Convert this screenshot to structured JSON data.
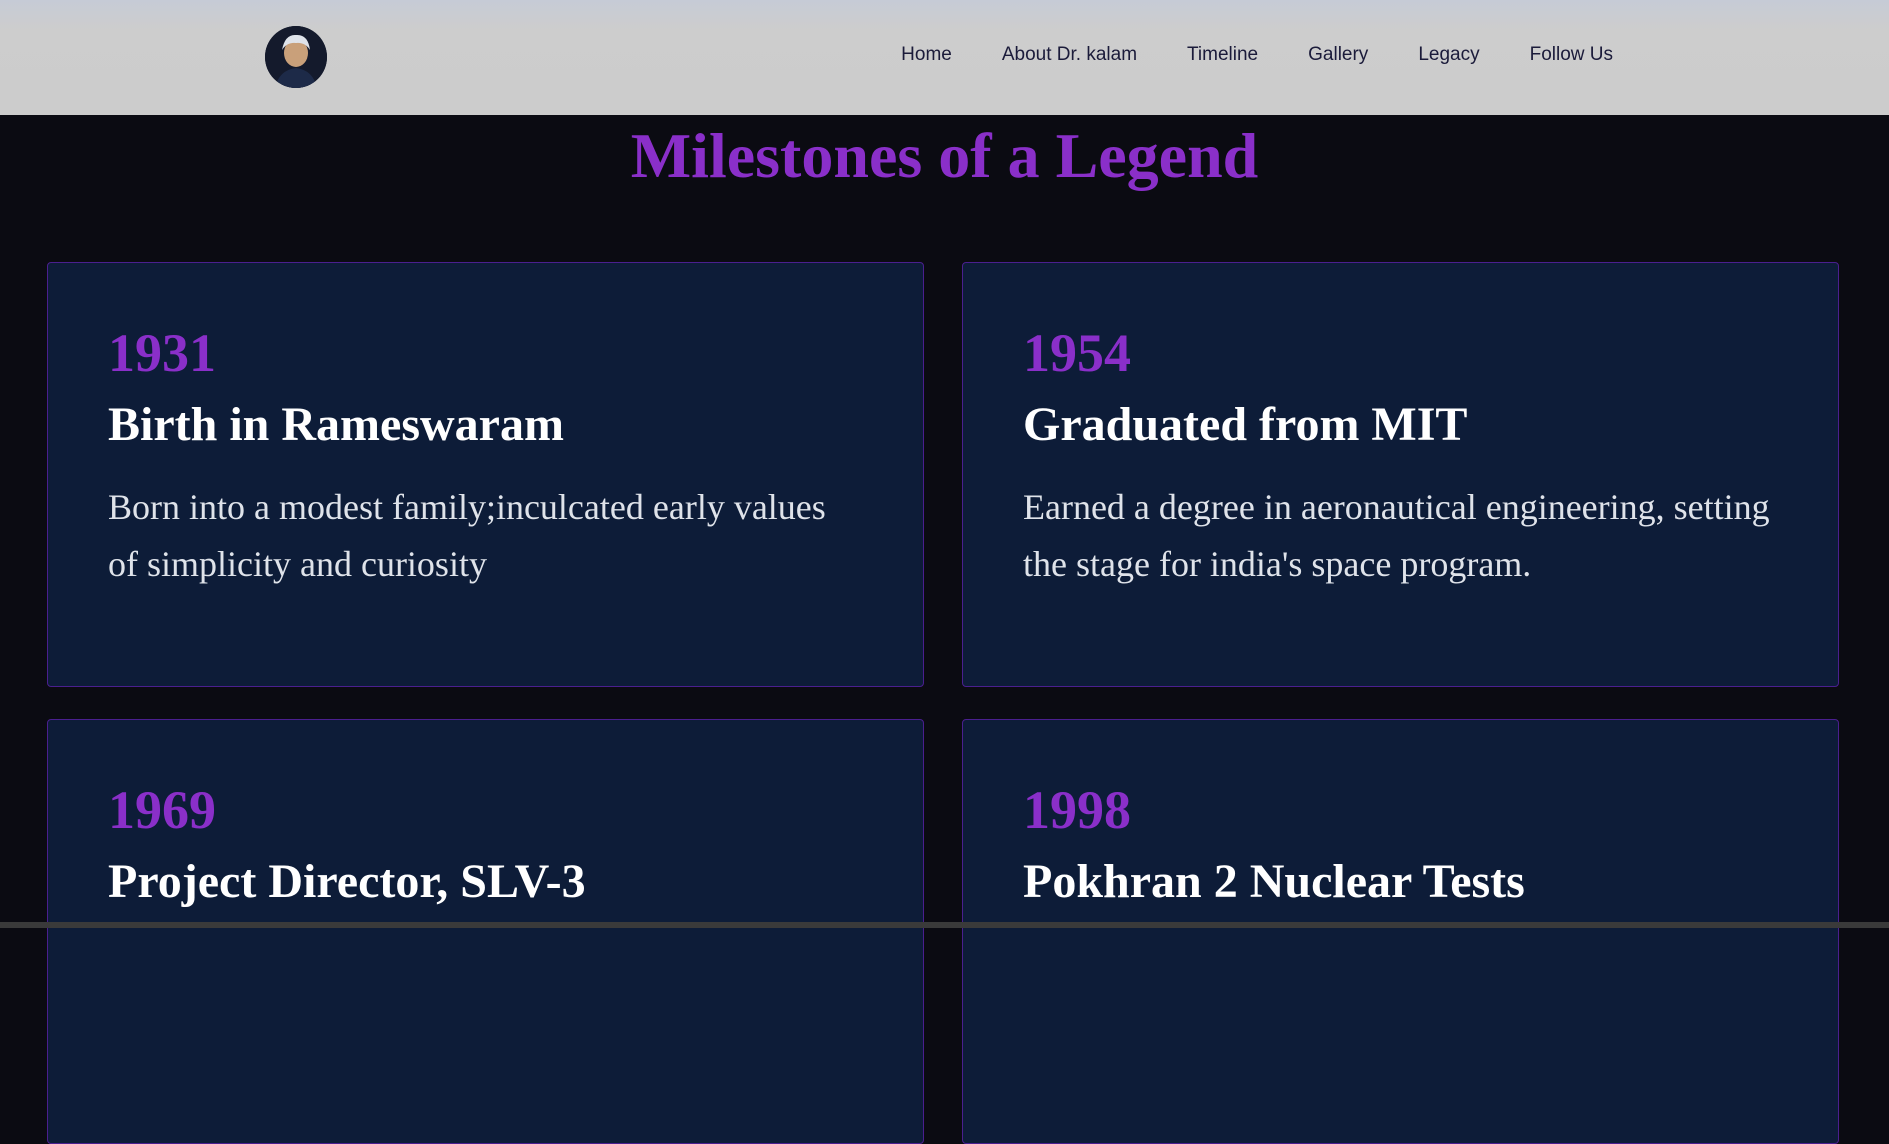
{
  "nav": {
    "avatar_alt": "Dr. Kalam portrait",
    "links": [
      "Home",
      "About Dr. kalam",
      "Timeline",
      "Gallery",
      "Legacy",
      "Follow Us"
    ]
  },
  "page": {
    "title": "Milestones of a Legend"
  },
  "milestones": [
    {
      "year": "1931",
      "heading": "Birth in Rameswaram",
      "text": "Born into a modest family;inculcated early values of simplicity and curiosity"
    },
    {
      "year": "1954",
      "heading": "Graduated from MIT",
      "text": "Earned a degree in aeronautical engineering, setting the stage for india's space program."
    },
    {
      "year": "1969",
      "heading": "Project Director, SLV-3",
      "text": ""
    },
    {
      "year": "1998",
      "heading": "Pokhran 2 Nuclear Tests",
      "text": ""
    }
  ],
  "colors": {
    "accent": "#8a2fc9",
    "card_bg": "#0d1c38",
    "page_bg": "#0b0b12",
    "navbar_bg": "#cccccc"
  }
}
